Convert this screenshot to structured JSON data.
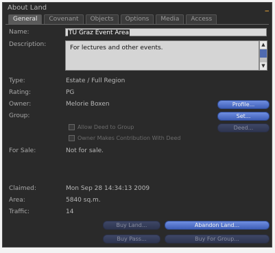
{
  "window": {
    "title": "About Land",
    "minimize_glyph": "_"
  },
  "tabs": [
    {
      "label": "General",
      "active": true
    },
    {
      "label": "Covenant"
    },
    {
      "label": "Objects"
    },
    {
      "label": "Options"
    },
    {
      "label": "Media"
    },
    {
      "label": "Access"
    }
  ],
  "fields": {
    "name_label": "Name:",
    "name_value": "TU Graz Event Area",
    "description_label": "Description:",
    "description_value": "For lectures and other events.",
    "type_label": "Type:",
    "type_value": "Estate / Full Region",
    "rating_label": "Rating:",
    "rating_value": "PG",
    "owner_label": "Owner:",
    "owner_value": "Melorie Boxen",
    "group_label": "Group:",
    "for_sale_label": "For Sale:",
    "for_sale_value": "Not for sale.",
    "claimed_label": "Claimed:",
    "claimed_value": "Mon Sep 28 14:34:13 2009",
    "area_label": "Area:",
    "area_value": "5840 sq.m.",
    "traffic_label": "Traffic:",
    "traffic_value": "14"
  },
  "checkboxes": {
    "allow_deed": "Allow Deed to Group",
    "owner_contribution": "Owner Makes Contribution With Deed"
  },
  "buttons": {
    "profile": "Profile...",
    "set": "Set...",
    "deed": "Deed...",
    "buy_land": "Buy Land...",
    "abandon_land": "Abandon Land...",
    "buy_pass": "Buy Pass...",
    "buy_for_group": "Buy For Group..."
  },
  "colors": {
    "window_bg": "#2a2a2a",
    "button_active": "#5577cc",
    "button_dim": "#363d5a",
    "accent": "#e6a63a"
  }
}
